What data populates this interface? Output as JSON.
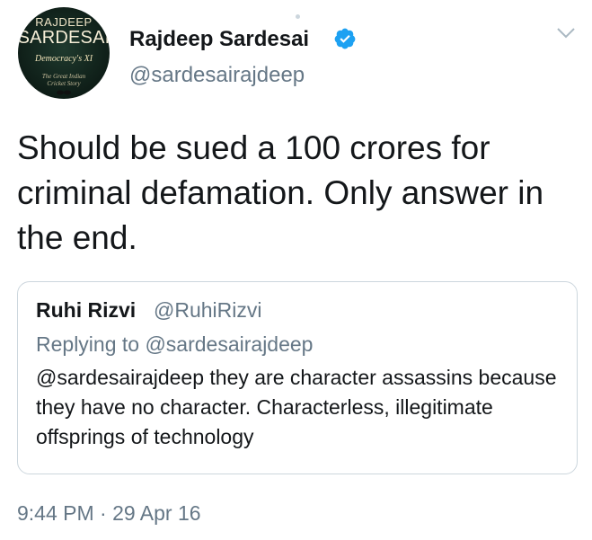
{
  "avatar": {
    "line1": "RAJDEEP",
    "line2": "SARDESAI",
    "line3": "Democracy's XI",
    "line4a": "The Great Indian",
    "line4b": "Cricket Story"
  },
  "author": {
    "name": "Rajdeep Sardesai",
    "handle": "@sardesairajdeep",
    "verified_icon": "verified-badge-icon",
    "verified_color": "#1da1f2"
  },
  "menu_icon": "chevron-down-icon",
  "tweet": {
    "text": "Should be sued a 100 crores for criminal defamation. Only answer in the end."
  },
  "quoted_tweet": {
    "name": "Ruhi Rizvi",
    "handle": "@RuhiRizvi",
    "replying_to": "Replying to @sardesairajdeep",
    "text": "@sardesairajdeep  they are character assassins because they have no character. Characterless, illegitimate offsprings of technology"
  },
  "timestamp": "9:44 PM · 29 Apr 16",
  "colors": {
    "primary_text": "#14171a",
    "secondary_text": "#657786",
    "border": "#ccd6dd"
  }
}
